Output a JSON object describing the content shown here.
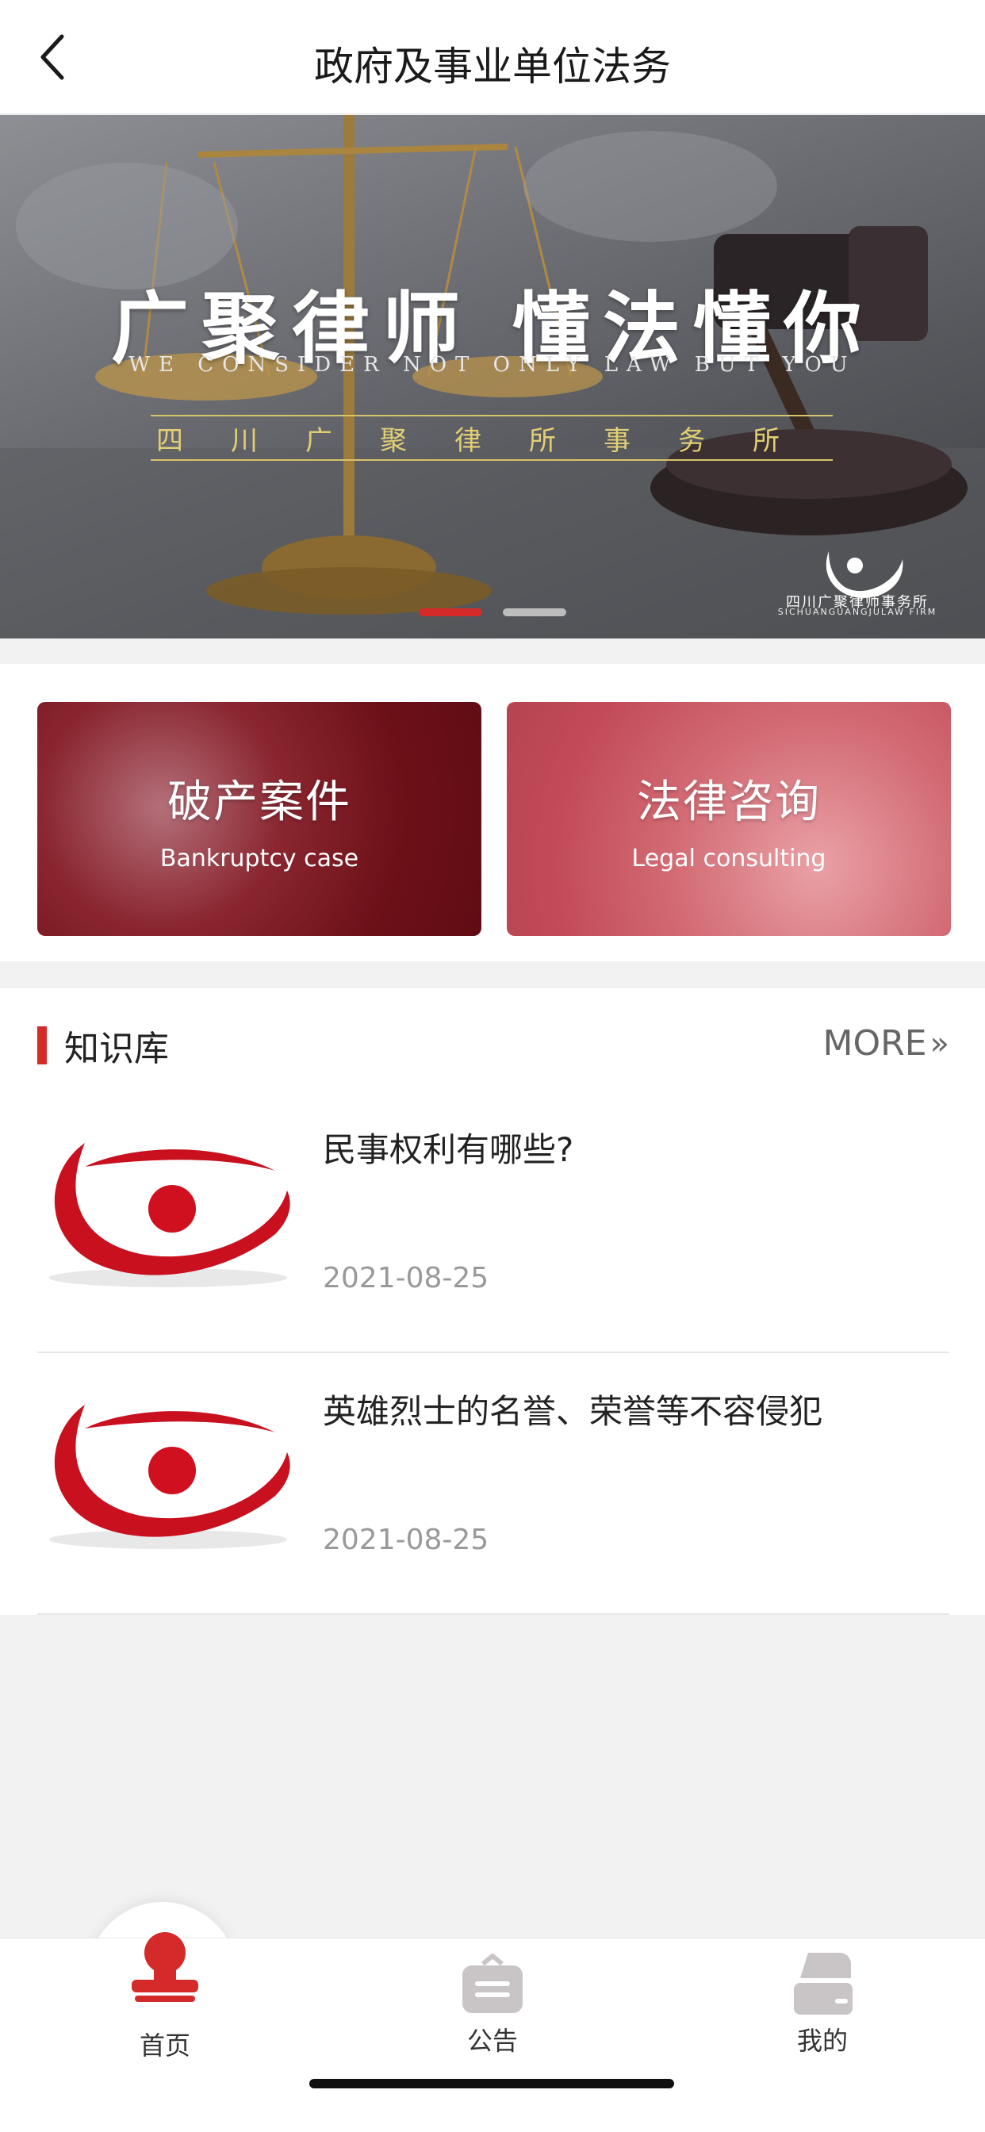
{
  "header": {
    "title": "政府及事业单位法务"
  },
  "banner": {
    "headline": "广聚律师  懂法懂你",
    "tagline": "WE CONSIDER NOT ONLY LAW BUT YOU",
    "firm_name": "四川广聚律所事务所",
    "logo_name": "四川广聚律师事务所",
    "logo_en": "SICHUANGUANGJULAW FIRM",
    "slides": 2,
    "active_slide": 1
  },
  "services": [
    {
      "title": "破产案件",
      "subtitle": "Bankruptcy case"
    },
    {
      "title": "法律咨询",
      "subtitle": "Legal consulting"
    }
  ],
  "knowledge": {
    "title": "知识库",
    "more_label": "MORE",
    "items": [
      {
        "title": "民事权利有哪些?",
        "date": "2021-08-25"
      },
      {
        "title": "英雄烈士的名誉、荣誉等不容侵犯",
        "date": "2021-08-25"
      }
    ]
  },
  "tabbar": {
    "tabs": [
      {
        "label": "首页",
        "icon": "stamp-icon",
        "active": true
      },
      {
        "label": "公告",
        "icon": "briefcase-icon",
        "active": false
      },
      {
        "label": "我的",
        "icon": "user-icon",
        "active": false
      }
    ]
  },
  "colors": {
    "accent": "#d42a2a",
    "card_dark": "#6d1018",
    "card_light": "#c24b57",
    "inactive_icon": "#c9c5c6"
  }
}
